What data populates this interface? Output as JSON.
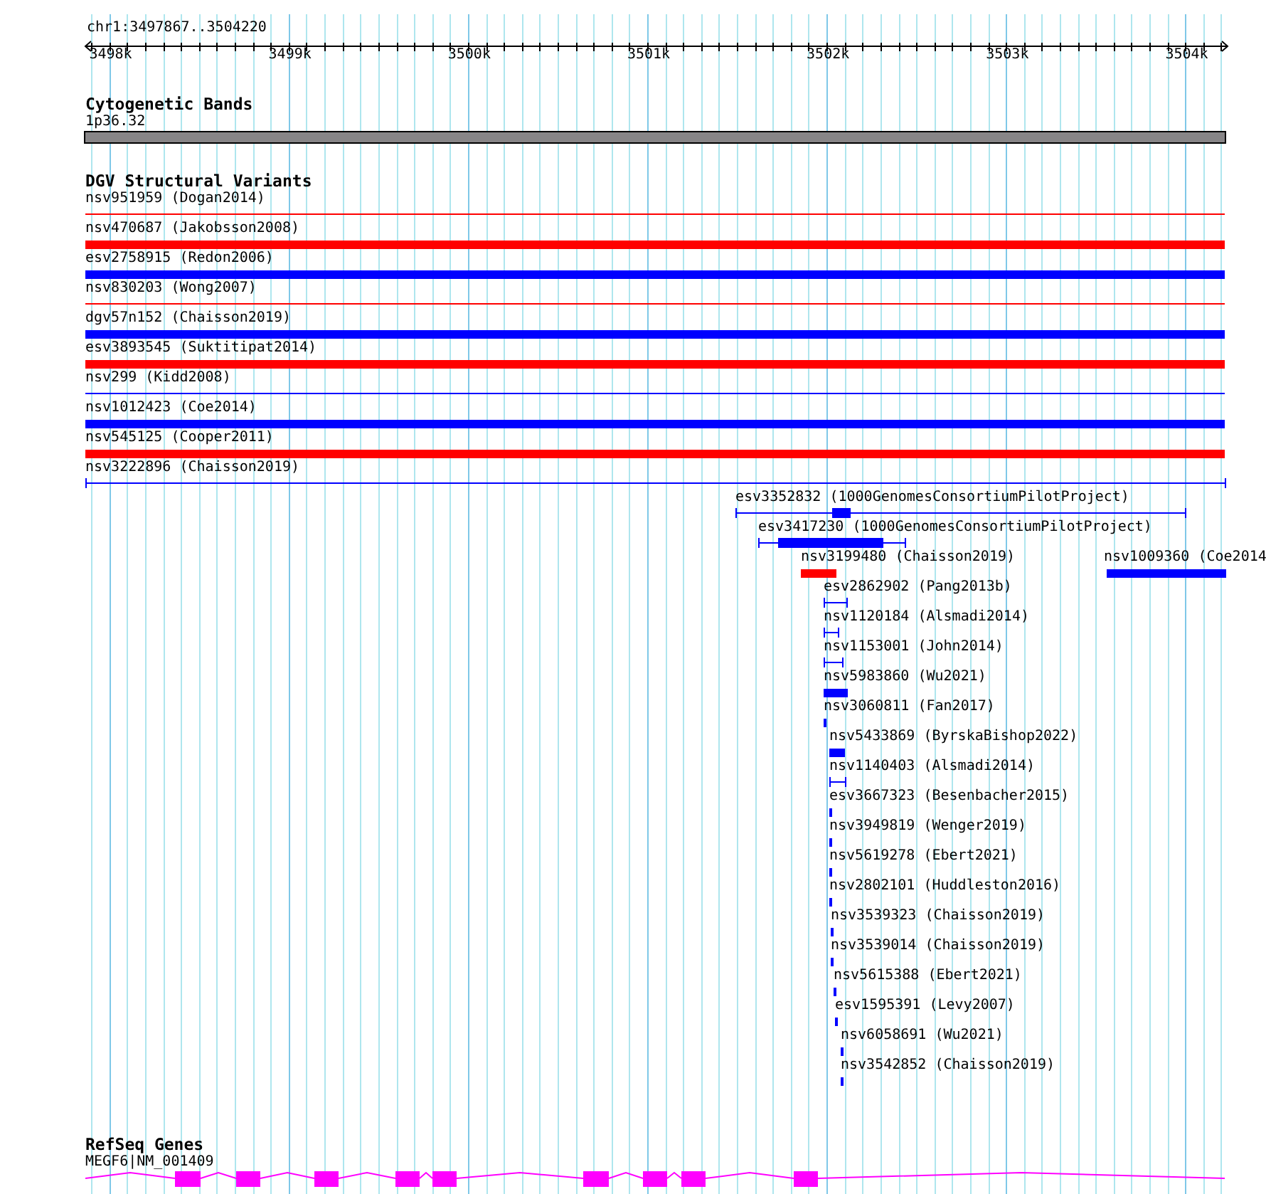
{
  "ruler": {
    "location": "chr1:3497867..3504220",
    "ticks": [
      "3498k",
      "3499k",
      "3500k",
      "3501k",
      "3502k",
      "3503k",
      "3504k"
    ]
  },
  "cytogenetic_bands": {
    "title": "Cytogenetic Bands",
    "band": {
      "label": "1p36.32"
    }
  },
  "dgv_structural_variants": {
    "title": "DGV Structural Variants",
    "features": [
      {
        "label": "nsv951959 (Dogan2014)",
        "kind": "line",
        "color": "#ff0000"
      },
      {
        "label": "nsv470687 (Jakobsson2008)",
        "kind": "bar",
        "color": "#ff0000"
      },
      {
        "label": "esv2758915 (Redon2006)",
        "kind": "bar",
        "color": "#0000ff"
      },
      {
        "label": "nsv830203 (Wong2007)",
        "kind": "line",
        "color": "#ff0000"
      },
      {
        "label": "dgv57n152 (Chaisson2019)",
        "kind": "bar",
        "color": "#0000ff"
      },
      {
        "label": "esv3893545 (Suktitipat2014)",
        "kind": "bar",
        "color": "#ff0000"
      },
      {
        "label": "nsv299 (Kidd2008)",
        "kind": "line",
        "color": "#0000ff"
      },
      {
        "label": "nsv1012423 (Coe2014)",
        "kind": "bar",
        "color": "#0000ff"
      },
      {
        "label": "nsv545125 (Cooper2011)",
        "kind": "bar",
        "color": "#ff0000"
      },
      {
        "label": "nsv3222896 (Chaisson2019)",
        "kind": "capped",
        "color": "#0000ff"
      },
      {
        "label": "esv3352832 (1000GenomesConsortiumPilotProject)",
        "kind": "capped",
        "color": "#0000ff"
      },
      {
        "label": "esv3417230 (1000GenomesConsortiumPilotProject)",
        "kind": "capped",
        "color": "#0000ff"
      },
      {
        "label": "nsv3199480 (Chaisson2019)",
        "kind": "bar",
        "color": "#ff0000"
      },
      {
        "label": "nsv1009360 (Coe2014",
        "kind": "bar",
        "color": "#0000ff"
      },
      {
        "label": "esv2862902 (Pang2013b)",
        "kind": "capped",
        "color": "#0000ff"
      },
      {
        "label": "nsv1120184 (Alsmadi2014)",
        "kind": "capped",
        "color": "#0000ff"
      },
      {
        "label": "nsv1153001 (John2014)",
        "kind": "capped",
        "color": "#0000ff"
      },
      {
        "label": "nsv5983860 (Wu2021)",
        "kind": "bar",
        "color": "#0000ff"
      },
      {
        "label": "nsv3060811 (Fan2017)",
        "kind": "bar",
        "color": "#0000ff"
      },
      {
        "label": "nsv5433869 (ByrskaBishop2022)",
        "kind": "bar",
        "color": "#0000ff"
      },
      {
        "label": "nsv1140403 (Alsmadi2014)",
        "kind": "capped",
        "color": "#0000ff"
      },
      {
        "label": "esv3667323 (Besenbacher2015)",
        "kind": "bar",
        "color": "#0000ff"
      },
      {
        "label": "nsv3949819 (Wenger2019)",
        "kind": "bar",
        "color": "#0000ff"
      },
      {
        "label": "nsv5619278 (Ebert2021)",
        "kind": "bar",
        "color": "#0000ff"
      },
      {
        "label": "nsv2802101 (Huddleston2016)",
        "kind": "bar",
        "color": "#0000ff"
      },
      {
        "label": "nsv3539323 (Chaisson2019)",
        "kind": "bar",
        "color": "#0000ff"
      },
      {
        "label": "nsv3539014 (Chaisson2019)",
        "kind": "bar",
        "color": "#0000ff"
      },
      {
        "label": "nsv5615388 (Ebert2021)",
        "kind": "bar",
        "color": "#0000ff"
      },
      {
        "label": "esv1595391 (Levy2007)",
        "kind": "bar",
        "color": "#0000ff"
      },
      {
        "label": "nsv6058691 (Wu2021)",
        "kind": "bar",
        "color": "#0000ff"
      },
      {
        "label": "nsv3542852 (Chaisson2019)",
        "kind": "bar",
        "color": "#0000ff"
      }
    ]
  },
  "refseq_genes": {
    "title": "RefSeq Genes",
    "gene": {
      "label": "MEGF6|NM_001409"
    }
  }
}
